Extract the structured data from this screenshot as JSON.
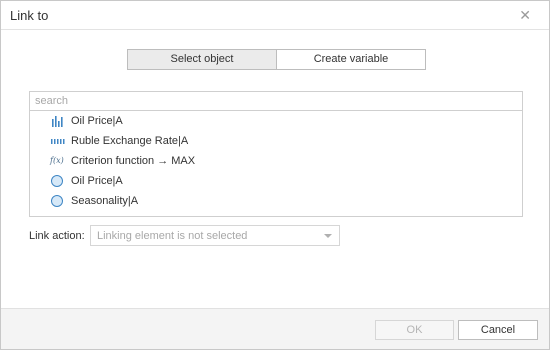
{
  "dialog": {
    "title": "Link to",
    "close_icon": "close-icon"
  },
  "tabs": [
    {
      "label": "Select object",
      "active": true
    },
    {
      "label": "Create variable",
      "active": false
    }
  ],
  "search": {
    "placeholder": "search",
    "value": ""
  },
  "list": {
    "items": [
      {
        "label": "Oil Price|A",
        "icon": "bar-series-icon"
      },
      {
        "label": "Ruble Exchange Rate|A",
        "icon": "dashed-series-icon"
      },
      {
        "label": "Criterion function → MAX",
        "icon": "function-icon",
        "icon_text": "f(x)"
      },
      {
        "label": "Oil Price|A",
        "icon": "radio-node-icon"
      },
      {
        "label": "Seasonality|A",
        "icon": "radio-node-icon"
      }
    ]
  },
  "link_action": {
    "label": "Link action:",
    "selected_value": "Linking element is not selected"
  },
  "footer": {
    "ok_label": "OK",
    "cancel_label": "Cancel"
  },
  "colors": {
    "icon_blue": "#3f86c4",
    "radio_fill": "#d7e9f8",
    "footer_bg": "#f4f4f4",
    "active_tab_bg": "#ebebeb"
  }
}
